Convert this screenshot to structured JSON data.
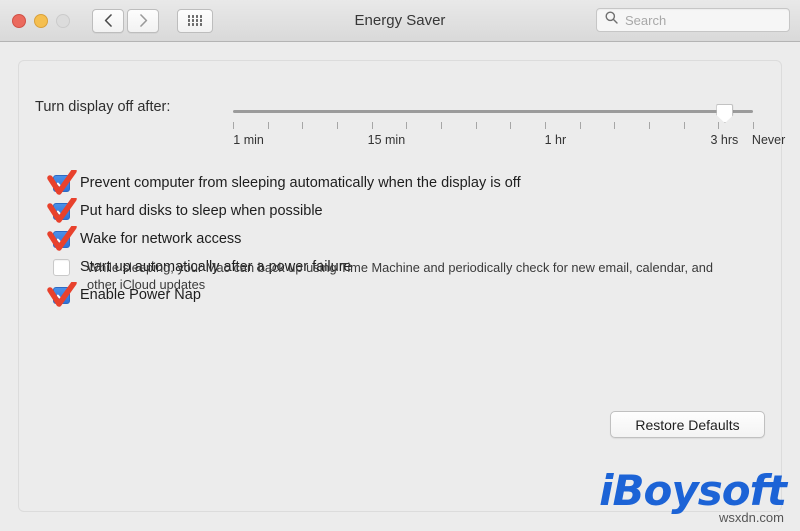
{
  "window": {
    "title": "Energy Saver",
    "traffic_lights": [
      {
        "name": "close",
        "color": "#eb6a5e"
      },
      {
        "name": "minimize",
        "color": "#f5bf50"
      },
      {
        "name": "zoom",
        "color": "#dcdcdc"
      }
    ],
    "back_label": "Back",
    "forward_label": "Forward",
    "show_all_label": "Show All"
  },
  "search": {
    "placeholder": "Search",
    "value": ""
  },
  "slider": {
    "label": "Turn display off after:",
    "value": "3 hrs",
    "thumb_percent": 94.5,
    "tick_count": 16,
    "tick_labels": [
      {
        "text": "1 min",
        "percent": 3
      },
      {
        "text": "15 min",
        "percent": 29.5
      },
      {
        "text": "1 hr",
        "percent": 62
      },
      {
        "text": "3 hrs",
        "percent": 94.5
      },
      {
        "text": "Never",
        "percent": 103
      }
    ]
  },
  "options": [
    {
      "id": "prevent-sleep",
      "label": "Prevent computer from sleeping automatically when the display is off",
      "checked": true,
      "annotated": true
    },
    {
      "id": "hard-disk-sleep",
      "label": "Put hard disks to sleep when possible",
      "checked": true,
      "annotated": true
    },
    {
      "id": "wake-for-network",
      "label": "Wake for network access",
      "checked": true,
      "annotated": true
    },
    {
      "id": "startup-after-power-failure",
      "label": "Start up automatically after a power failure",
      "checked": false,
      "annotated": false
    },
    {
      "id": "enable-power-nap",
      "label": "Enable Power Nap",
      "checked": true,
      "annotated": true
    }
  ],
  "power_nap_description": "While sleeping, your Mac can back up using Time Machine and periodically check for new email, calendar, and other iCloud updates",
  "buttons": {
    "restore_defaults": "Restore Defaults"
  },
  "watermark": {
    "logo": "iBoysoft",
    "site": "wsxdn.com"
  },
  "colors": {
    "accent_blue": "#2f72d8",
    "annotation_red": "#e8412c",
    "window_bg": "#ececec",
    "titlebar_bg": "#e1e1e1",
    "watermark_blue": "#1c63d6"
  }
}
